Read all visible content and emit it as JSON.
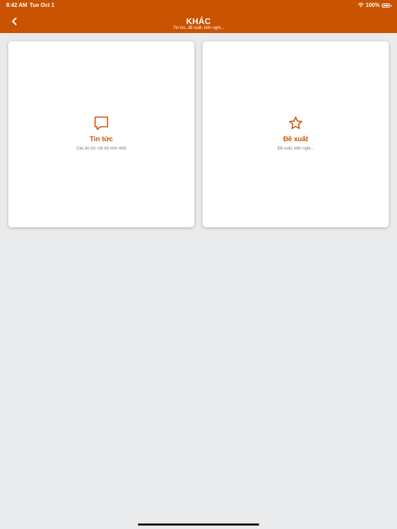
{
  "status": {
    "time": "8:42 AM",
    "date": "Tue Oct 1",
    "battery": "100%"
  },
  "header": {
    "title": "KHÁC",
    "subtitle": "Tin tức, đề xuất, kiến nghị..."
  },
  "cards": [
    {
      "title": "Tin tức",
      "description": "Các tin tức nội bộ mới nhất",
      "icon": "chat-bubble-icon"
    },
    {
      "title": "Đề xuất",
      "description": "Đề xuất, kiến nghị...",
      "icon": "star-icon"
    }
  ],
  "colors": {
    "accent": "#c95300",
    "background": "#e9eaec"
  }
}
